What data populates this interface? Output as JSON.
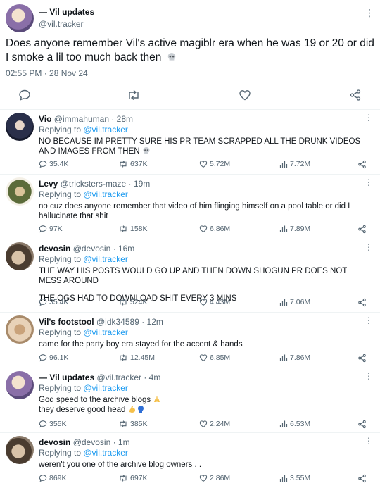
{
  "main": {
    "name": "— Vil updates",
    "handle": "@vil.tracker",
    "text": "Does anyone remember Vil's active magiblr era when he was 19 or 20 or did I smoke a lil too much back then",
    "time": "02:55 PM · 28 Nov 24"
  },
  "replies": [
    {
      "name": "Vio",
      "handle": "@immahuman · 28m",
      "replying_prefix": "Replying to ",
      "replying_to": "@vil.tracker",
      "text": "NO BECAUSE IM PRETTY SURE HIS PR TEAM SCRAPPED ALL THE DRUNK VIDEOS AND IMAGES FROM THEN",
      "replies": "35.4K",
      "retweets": "637K",
      "likes": "5.72M",
      "views": "7.72M"
    },
    {
      "name": "Levy",
      "handle": "@tricksters-maze · 19m",
      "replying_prefix": "Replying to ",
      "replying_to": "@vil.tracker",
      "text": "no cuz does anyone remember that video of him flinging himself on a pool table or did I hallucinate that shit",
      "replies": "97K",
      "retweets": "158K",
      "likes": "6.86M",
      "views": "7.89M"
    },
    {
      "name": "devosin",
      "handle": "@devosin · 16m",
      "replying_prefix": "Replying to ",
      "replying_to": "@vil.tracker",
      "text": "THE WAY HIS POSTS WOULD GO UP AND THEN DOWN SHOGUN PR DOES NOT MESS AROUND",
      "text2": "THE OGS HAD TO DOWNLOAD SHIT EVERY 3 MINS",
      "replies": "35.4K",
      "retweets": "524K",
      "likes": "4.43M",
      "views": "7.06M"
    },
    {
      "name": "Vil's footstool",
      "handle": "@idk34589 · 12m",
      "replying_prefix": "Replying to ",
      "replying_to": "@vil.tracker",
      "text": "came for the party boy era stayed for the accent & hands",
      "replies": "96.1K",
      "retweets": "12.45M",
      "likes": "6.85M",
      "views": "7.86M"
    },
    {
      "name": "— Vil updates",
      "handle": "@vil.tracker · 4m",
      "replying_prefix": "Replying to ",
      "replying_to": "@vil.tracker",
      "text": "God speed to the archive blogs",
      "text2": "they deserve good head",
      "replies": "355K",
      "retweets": "385K",
      "likes": "2.24M",
      "views": "6.53M"
    },
    {
      "name": "devosin",
      "handle": "@devosin · 1m",
      "replying_prefix": "Replying to ",
      "replying_to": "@vil.tracker",
      "text": "weren't you one of the archive blog owners . .",
      "replies": "869K",
      "retweets": "697K",
      "likes": "2.86M",
      "views": "3.55M"
    }
  ],
  "icons": {
    "reply": "reply-icon",
    "retweet": "retweet-icon",
    "like": "heart-icon",
    "views": "views-icon",
    "share": "share-icon",
    "more": "more-vertical-icon"
  },
  "colors": {
    "link": "#1d9bf0",
    "muted": "#536471",
    "text": "#0f1419"
  }
}
